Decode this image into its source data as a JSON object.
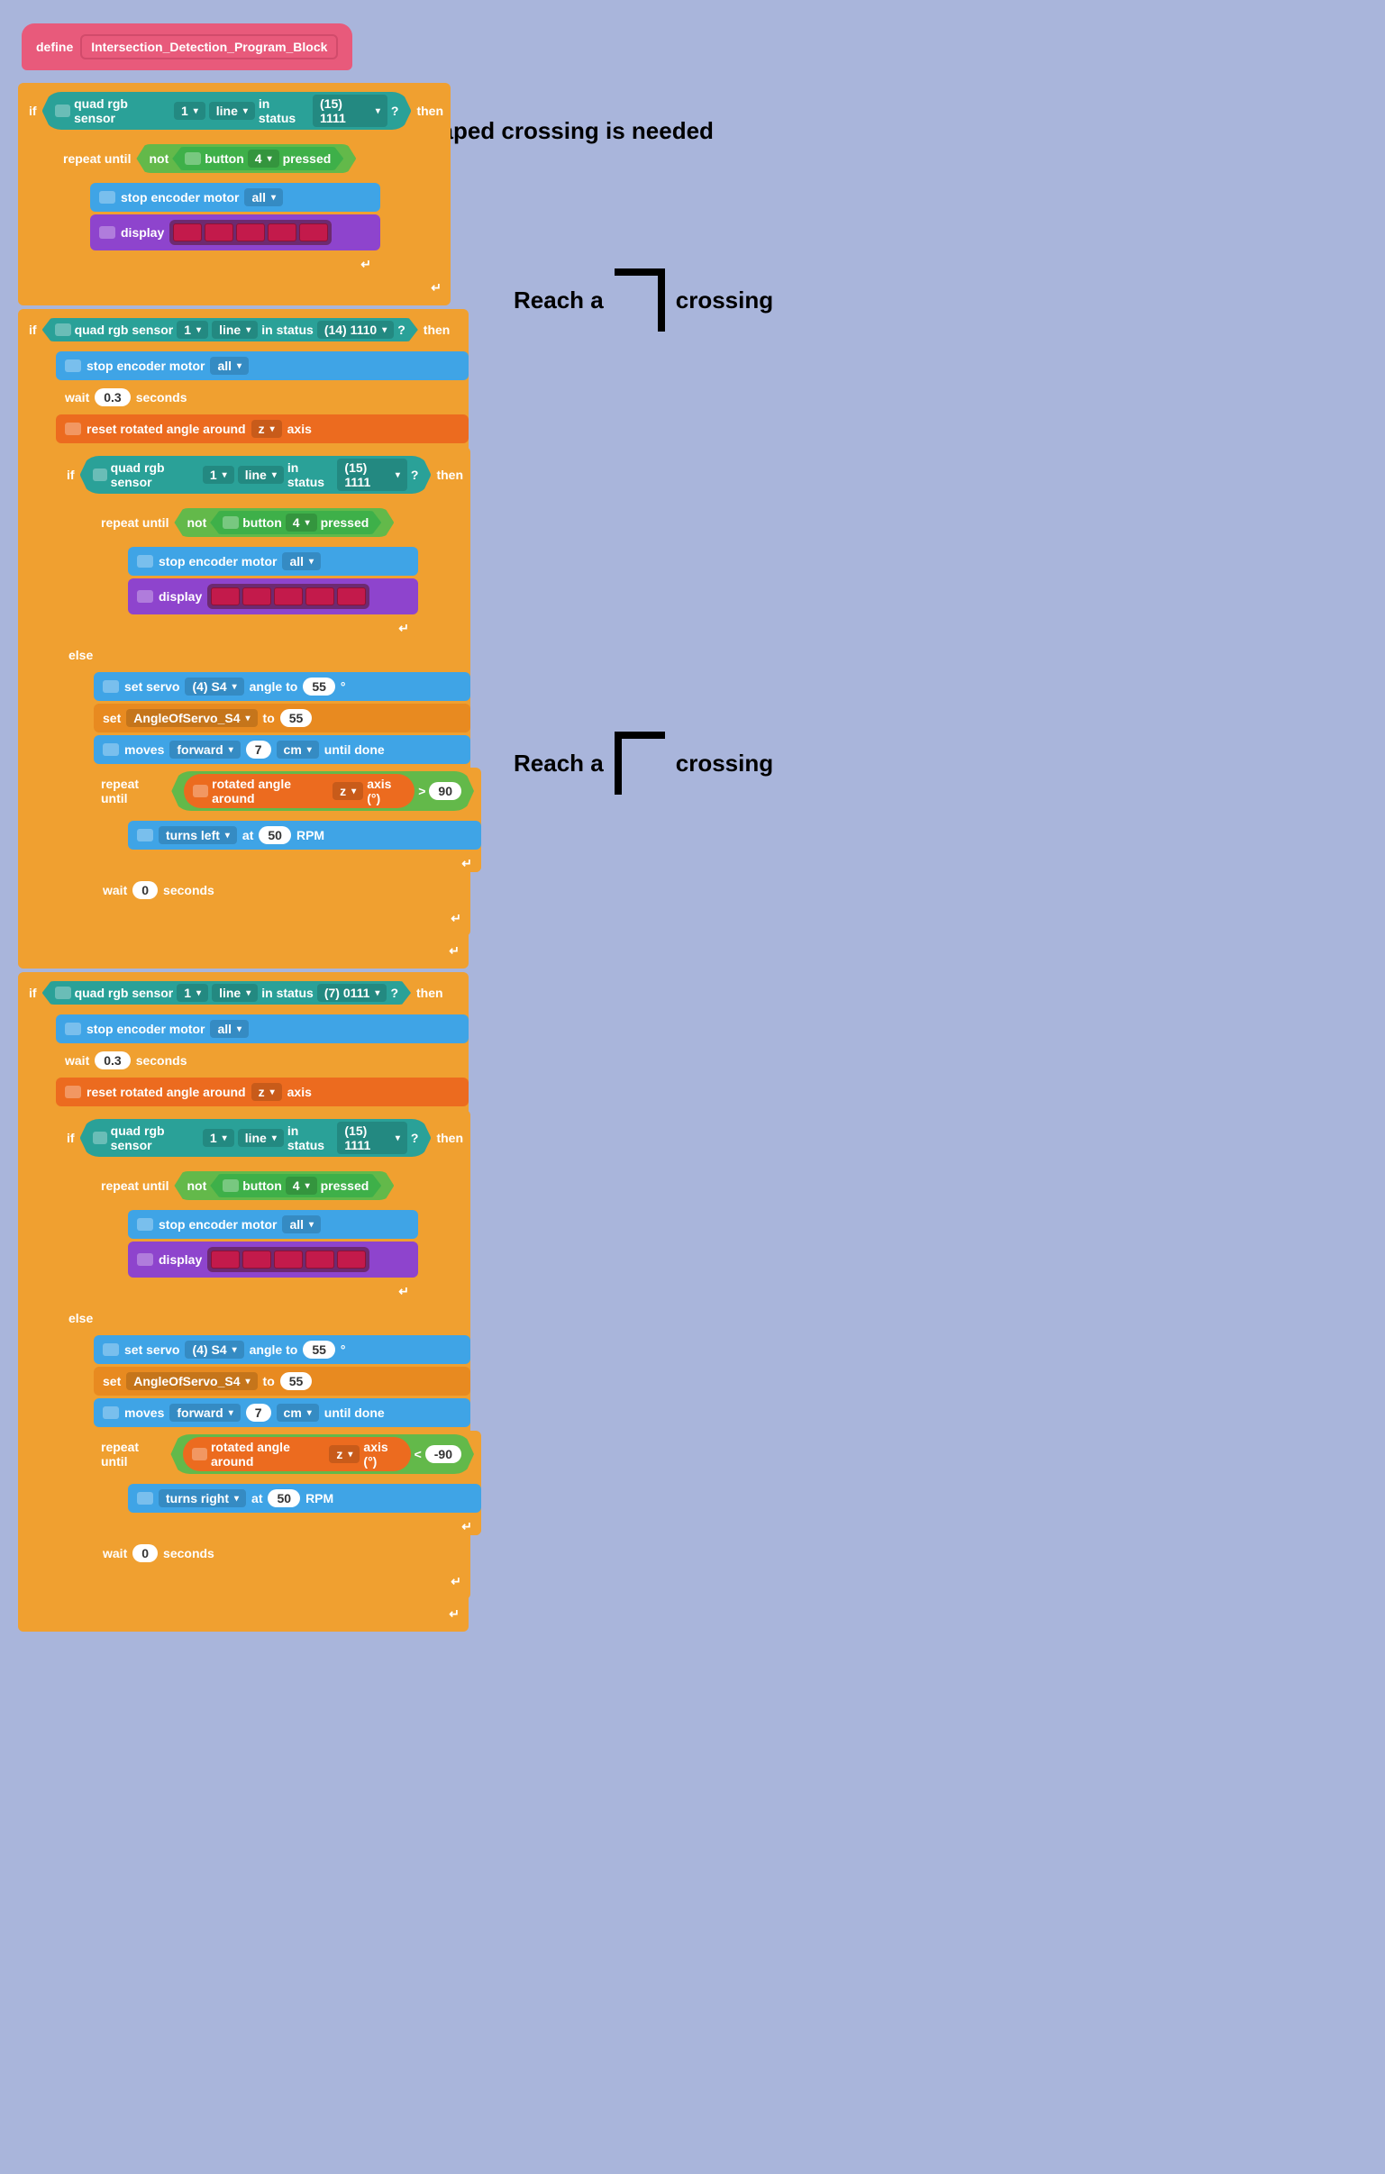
{
  "define": {
    "label": "define",
    "name": "Intersection_Detection_Program_Block"
  },
  "sensor": {
    "label": "quad rgb sensor",
    "port": "1",
    "probe": "line",
    "status": "in status"
  },
  "statuses": {
    "s1111": "(15) 1111",
    "s1110": "(14) 1110",
    "s0111": "(7) 0111"
  },
  "q": "?",
  "if": "if",
  "then": "then",
  "else": "else",
  "repeat_until": "repeat until",
  "not": "not",
  "button": {
    "label": "button",
    "num": "4",
    "state": "pressed"
  },
  "stop": {
    "label": "stop encoder motor",
    "target": "all"
  },
  "display": "display",
  "wait": "wait",
  "seconds": "seconds",
  "wait03": "0.3",
  "wait0": "0",
  "reset": {
    "label": "reset rotated angle around",
    "axis": "z",
    "axistxt": "axis"
  },
  "servo": {
    "set": "set servo",
    "port": "(4) S4",
    "angleto": "angle to",
    "val": "55",
    "deg": "°"
  },
  "setvar": {
    "set": "set",
    "var": "AngleOfServo_S4",
    "to": "to",
    "val": "55"
  },
  "moves": {
    "label": "moves",
    "dir": "forward",
    "dist": "7",
    "unit": "cm",
    "until": "until done"
  },
  "rot": {
    "label": "rotated angle around",
    "axis": "z",
    "axistxt": "axis (°)"
  },
  "gt": ">",
  "lt": "<",
  "ninety": "90",
  "negninety": "-90",
  "turns": {
    "left": "turns left",
    "right": "turns right",
    "at": "at",
    "rpm": "50",
    "rpmtxt": "RPM"
  },
  "annotations": {
    "t": "A T-shaped crossing is needed",
    "r1a": "Reach a",
    "r1b": "crossing",
    "r2a": "Reach a",
    "r2b": "crossing"
  }
}
